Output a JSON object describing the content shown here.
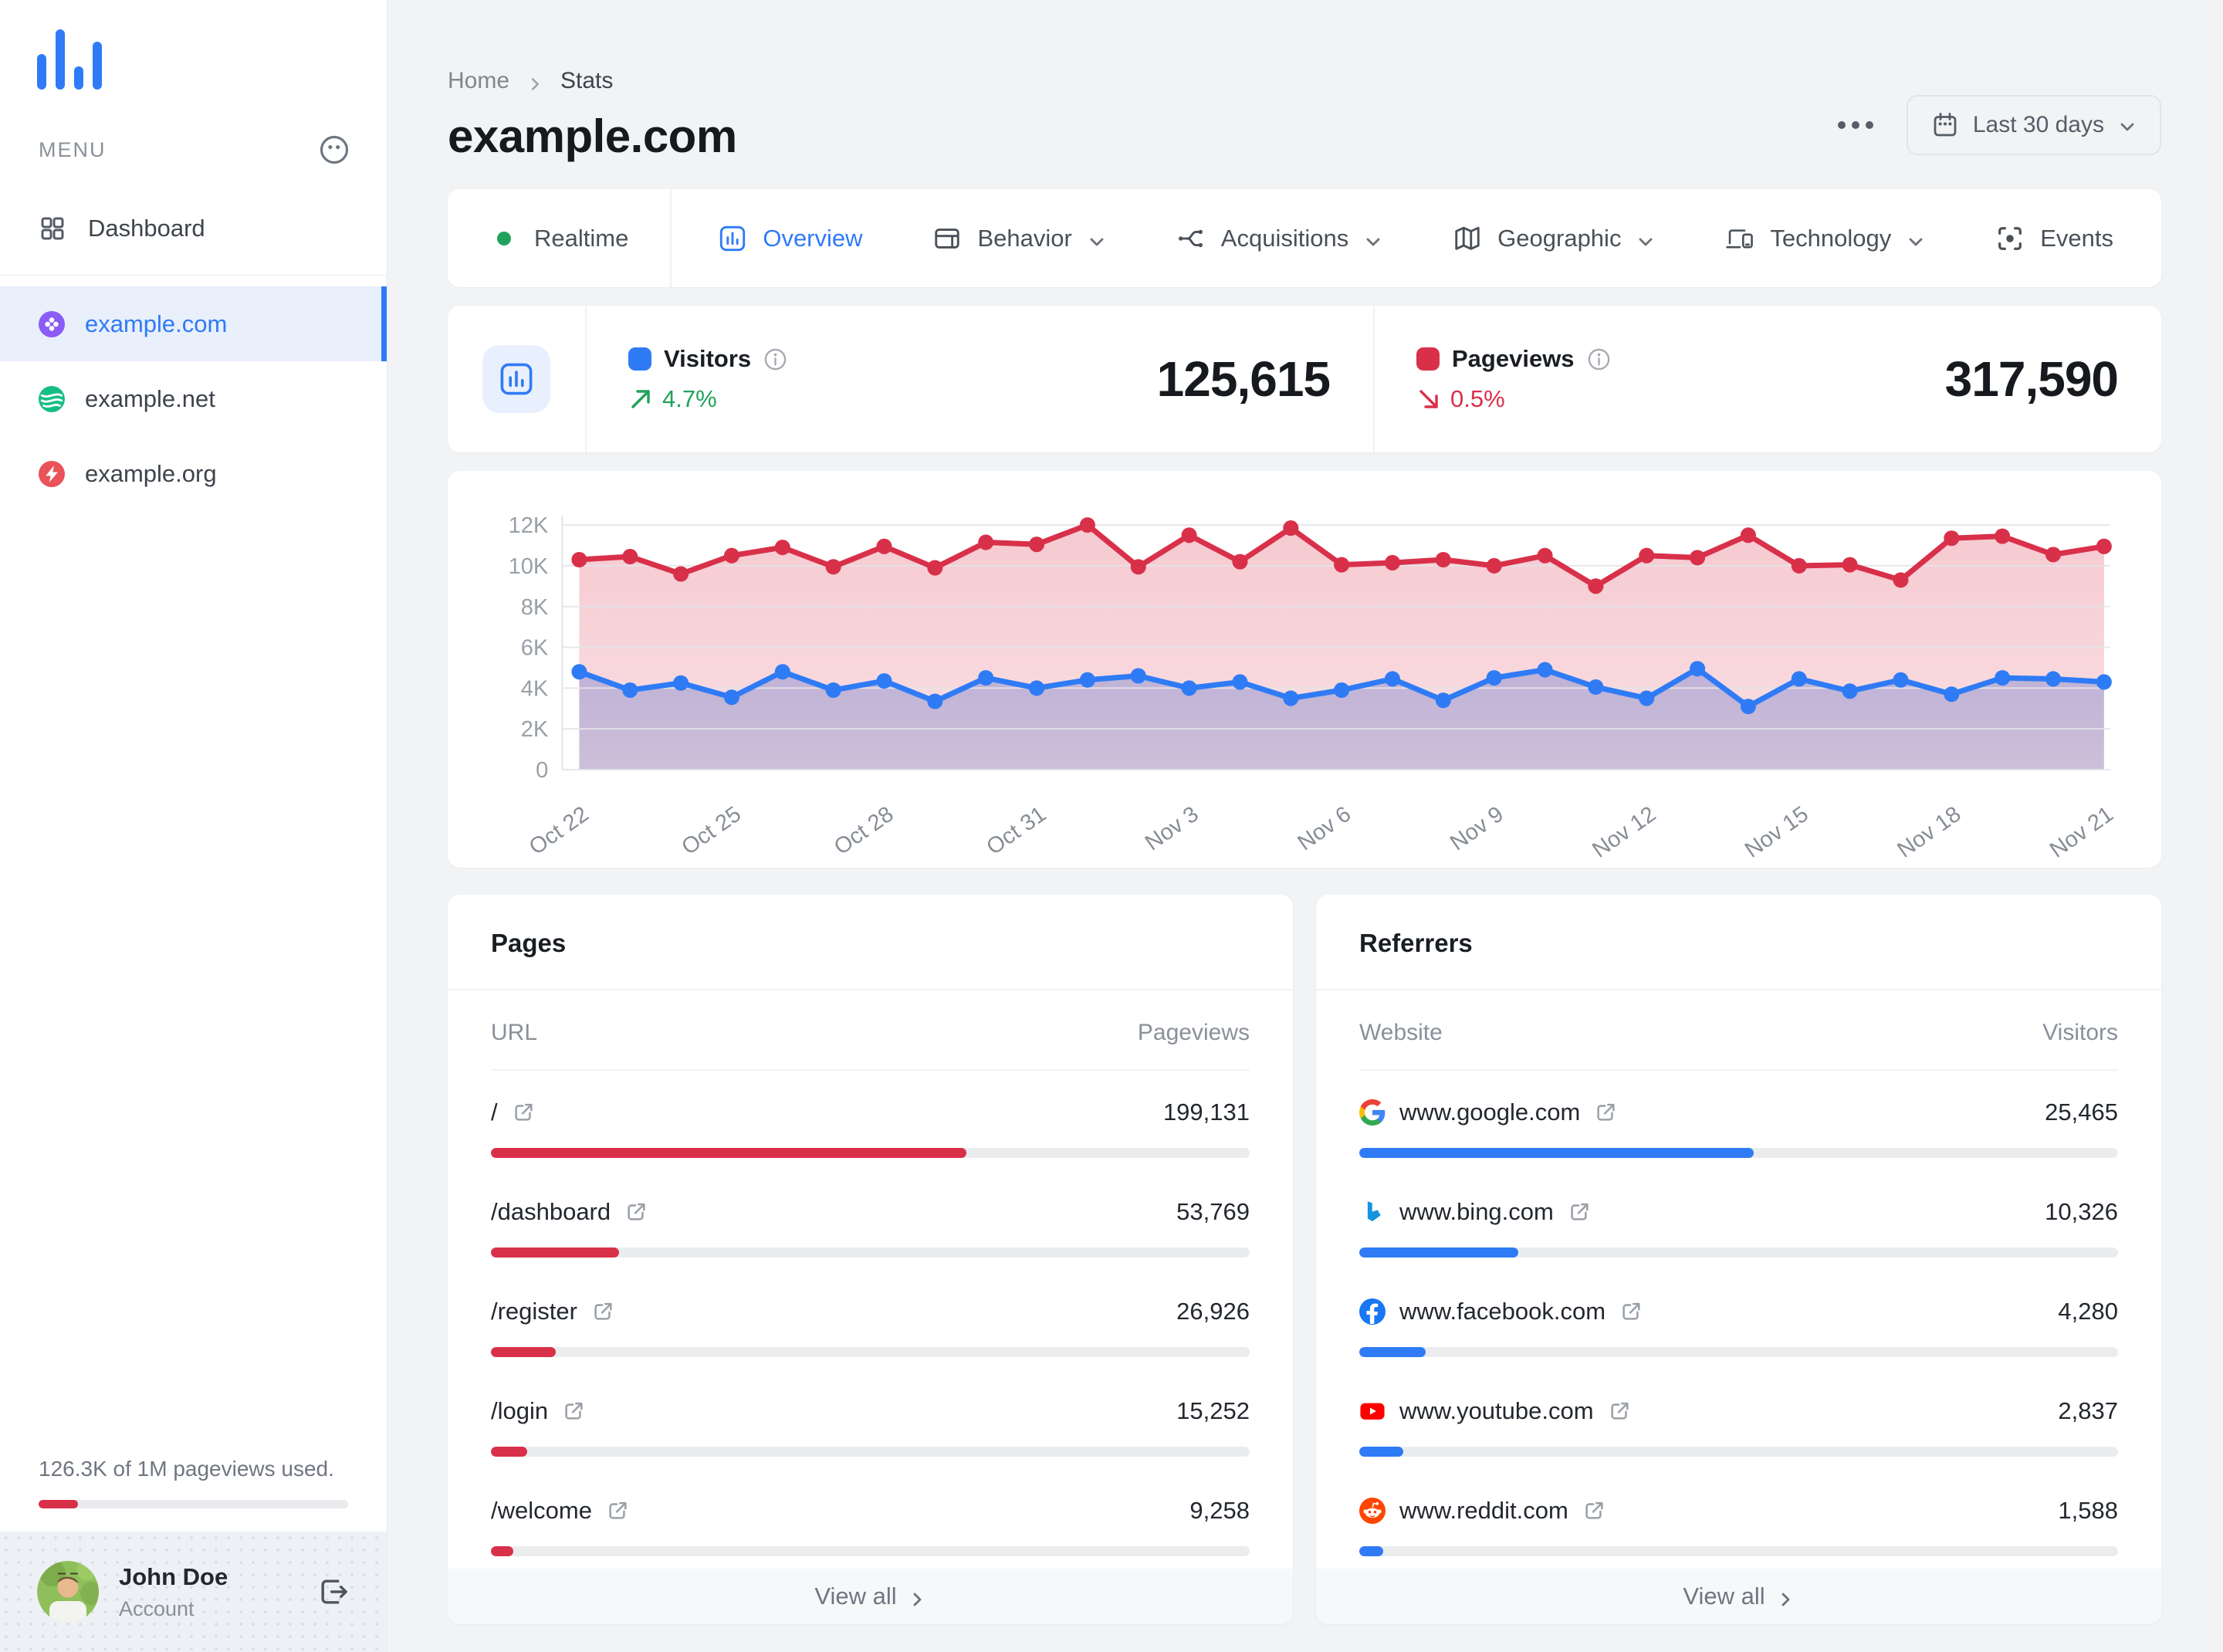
{
  "colors": {
    "blue": "#2F7BF5",
    "red": "#D9304A",
    "green": "#1FA35C"
  },
  "sidebar": {
    "menu_label": "MENU",
    "items": [
      {
        "label": "Dashboard",
        "icon": "dashboard"
      }
    ],
    "sites": [
      {
        "label": "example.com",
        "icon": "com",
        "active": true
      },
      {
        "label": "example.net",
        "icon": "net",
        "active": false
      },
      {
        "label": "example.org",
        "icon": "org",
        "active": false
      }
    ],
    "usage_text": "126.3K of 1M pageviews used.",
    "usage_percent": 12.6,
    "user": {
      "name": "John Doe",
      "role": "Account"
    }
  },
  "header": {
    "breadcrumb": [
      "Home",
      "Stats"
    ],
    "title": "example.com",
    "date_range": "Last 30 days"
  },
  "tabs": [
    {
      "label": "Realtime",
      "icon": "realtime"
    },
    {
      "label": "Overview",
      "icon": "overview",
      "active": true
    },
    {
      "label": "Behavior",
      "icon": "behavior",
      "dropdown": true
    },
    {
      "label": "Acquisitions",
      "icon": "acquisitions",
      "dropdown": true
    },
    {
      "label": "Geographic",
      "icon": "geographic",
      "dropdown": true
    },
    {
      "label": "Technology",
      "icon": "technology",
      "dropdown": true
    },
    {
      "label": "Events",
      "icon": "events"
    }
  ],
  "stats": {
    "visitors": {
      "label": "Visitors",
      "value": "125,615",
      "change": "4.7%",
      "direction": "up"
    },
    "pageviews": {
      "label": "Pageviews",
      "value": "317,590",
      "change": "0.5%",
      "direction": "down"
    }
  },
  "chart_data": {
    "type": "line",
    "x": [
      "Oct 22",
      "Oct 23",
      "Oct 24",
      "Oct 25",
      "Oct 26",
      "Oct 27",
      "Oct 28",
      "Oct 29",
      "Oct 30",
      "Oct 31",
      "Nov 1",
      "Nov 2",
      "Nov 3",
      "Nov 4",
      "Nov 5",
      "Nov 6",
      "Nov 7",
      "Nov 8",
      "Nov 9",
      "Nov 10",
      "Nov 11",
      "Nov 12",
      "Nov 13",
      "Nov 14",
      "Nov 15",
      "Nov 16",
      "Nov 17",
      "Nov 18",
      "Nov 19",
      "Nov 20",
      "Nov 21"
    ],
    "label_every": 3,
    "series": [
      {
        "name": "Visitors",
        "color": "#2F7BF5",
        "values": [
          4800,
          3900,
          4250,
          3550,
          4800,
          3900,
          4350,
          3350,
          4500,
          4000,
          4400,
          4600,
          4000,
          4300,
          3500,
          3900,
          4450,
          3400,
          4500,
          4900,
          4050,
          3500,
          4950,
          3100,
          4450,
          3850,
          4400,
          3700,
          4500,
          4450,
          4300
        ]
      },
      {
        "name": "Pageviews",
        "color": "#D9304A",
        "values": [
          10300,
          10450,
          9600,
          10500,
          10900,
          9950,
          10950,
          9900,
          11150,
          11050,
          12000,
          9950,
          11500,
          10200,
          11850,
          10050,
          10150,
          10300,
          10000,
          10500,
          9000,
          10500,
          10400,
          11500,
          10000,
          10050,
          9300,
          11350,
          11450,
          10550,
          10950
        ]
      }
    ],
    "ylim": [
      0,
      12000
    ],
    "yticks": [
      {
        "v": 0,
        "label": "0"
      },
      {
        "v": 2000,
        "label": "2K"
      },
      {
        "v": 4000,
        "label": "4K"
      },
      {
        "v": 6000,
        "label": "6K"
      },
      {
        "v": 8000,
        "label": "8K"
      },
      {
        "v": 10000,
        "label": "10K"
      },
      {
        "v": 12000,
        "label": "12K"
      }
    ],
    "grid": true,
    "legend": "none"
  },
  "pages": {
    "title": "Pages",
    "col_left": "URL",
    "col_right": "Pageviews",
    "rows": [
      {
        "label": "/",
        "value": "199,131",
        "percent": 62.7
      },
      {
        "label": "/dashboard",
        "value": "53,769",
        "percent": 16.9
      },
      {
        "label": "/register",
        "value": "26,926",
        "percent": 8.5
      },
      {
        "label": "/login",
        "value": "15,252",
        "percent": 4.8
      },
      {
        "label": "/welcome",
        "value": "9,258",
        "percent": 2.9
      }
    ],
    "footer": "View all"
  },
  "referrers": {
    "title": "Referrers",
    "col_left": "Website",
    "col_right": "Visitors",
    "rows": [
      {
        "label": "www.google.com",
        "icon": "google",
        "value": "25,465",
        "percent": 52
      },
      {
        "label": "www.bing.com",
        "icon": "bing",
        "value": "10,326",
        "percent": 21
      },
      {
        "label": "www.facebook.com",
        "icon": "facebook",
        "value": "4,280",
        "percent": 8.7
      },
      {
        "label": "www.youtube.com",
        "icon": "youtube",
        "value": "2,837",
        "percent": 5.8
      },
      {
        "label": "www.reddit.com",
        "icon": "reddit",
        "value": "1,588",
        "percent": 3.2
      }
    ],
    "footer": "View all"
  }
}
